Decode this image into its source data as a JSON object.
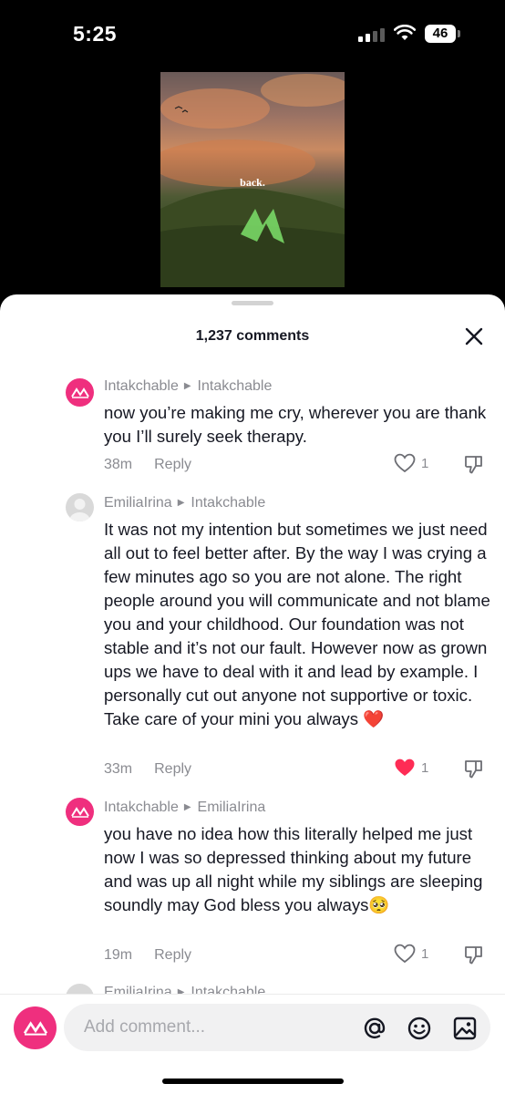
{
  "status": {
    "time": "5:25",
    "battery": "46"
  },
  "video": {
    "caption": "back."
  },
  "sheet": {
    "count_label": "1,237 comments"
  },
  "comments": [
    {
      "author": "Intakchable",
      "reply_to": "Intakchable",
      "text": "now you’re making me cry, wherever you are thank you I’ll surely seek therapy.",
      "time": "38m",
      "reply_label": "Reply",
      "likes": "1",
      "liked": false
    },
    {
      "author": "EmiliaIrina",
      "reply_to": "Intakchable",
      "text": "It was not my intention but sometimes we just need all out to feel better after. By the way I was crying a few minutes ago so you are not alone. The right people around you will communicate and not blame you and your childhood. Our foundation was not stable and it’s not our fault. However now as grown ups we have to deal with it and lead by example. I personally cut out anyone not supportive or toxic. Take care of your mini you always ❤️",
      "time": "33m",
      "reply_label": "Reply",
      "likes": "1",
      "liked": true
    },
    {
      "author": "Intakchable",
      "reply_to": "EmiliaIrina",
      "text": "you have no idea how this literally helped me just now I was so depressed thinking about my future and was up all night while my siblings are sleeping soundly may God bless you always🥺",
      "time": "19m",
      "reply_label": "Reply",
      "likes": "1",
      "liked": false
    },
    {
      "author": "EmiliaIrina",
      "reply_to": "Intakchable"
    }
  ],
  "input": {
    "placeholder": "Add comment..."
  },
  "colors": {
    "brand": "#ef2f7e",
    "like_red": "#fe2c55",
    "muted": "#8a8b91"
  }
}
